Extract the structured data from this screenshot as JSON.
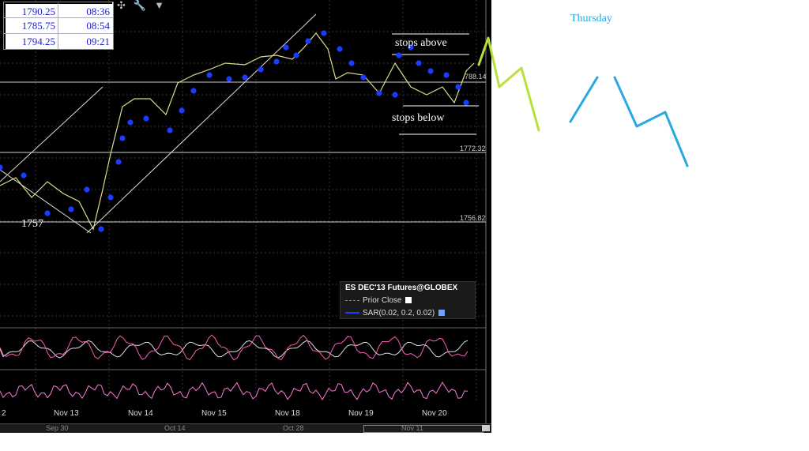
{
  "quotes": [
    {
      "price": "1790.25",
      "time": "08:36"
    },
    {
      "price": "1785.75",
      "time": "08:54"
    },
    {
      "price": "1794.25",
      "time": "09:21"
    }
  ],
  "toolbar": {
    "icons": [
      "crosshair-icon",
      "wrench-icon",
      "dropdown-icon"
    ]
  },
  "legend": {
    "title": "ES DEC'13 Futures@GLOBEX",
    "rows": [
      {
        "label": "Prior Close",
        "color": "#888888"
      },
      {
        "label": "SAR(0.02, 0.2, 0.02)",
        "color": "#1a3cff"
      }
    ]
  },
  "annotations": {
    "stops_above": "stops above",
    "stops_below": "stops below",
    "level_1757": "1757",
    "thursday": "Thursday"
  },
  "price_levels": [
    "788.14",
    "1772.32",
    "1756.82"
  ],
  "scrollbar": {
    "labels": [
      "Sep 30",
      "Oct 14",
      "Oct 28",
      "Nov 11"
    ]
  },
  "chart_data": {
    "type": "line",
    "x_ticks": [
      "2",
      "Nov 13",
      "Nov 14",
      "Nov 15",
      "Nov 18",
      "Nov 19",
      "Nov 20"
    ],
    "horizontal_levels": [
      1788.14,
      1772.32,
      1756.82
    ],
    "sar_params": "SAR(0.02, 0.2, 0.02)",
    "colors": {
      "price": "#ffffff",
      "sar": "#1a3cff",
      "osc1a": "#ff5ab4",
      "osc1b": "#e0e0e0",
      "osc2": "#ff7ad8",
      "projection_green": "#b8e03a",
      "projection_blue": "#2aa8e0"
    }
  }
}
